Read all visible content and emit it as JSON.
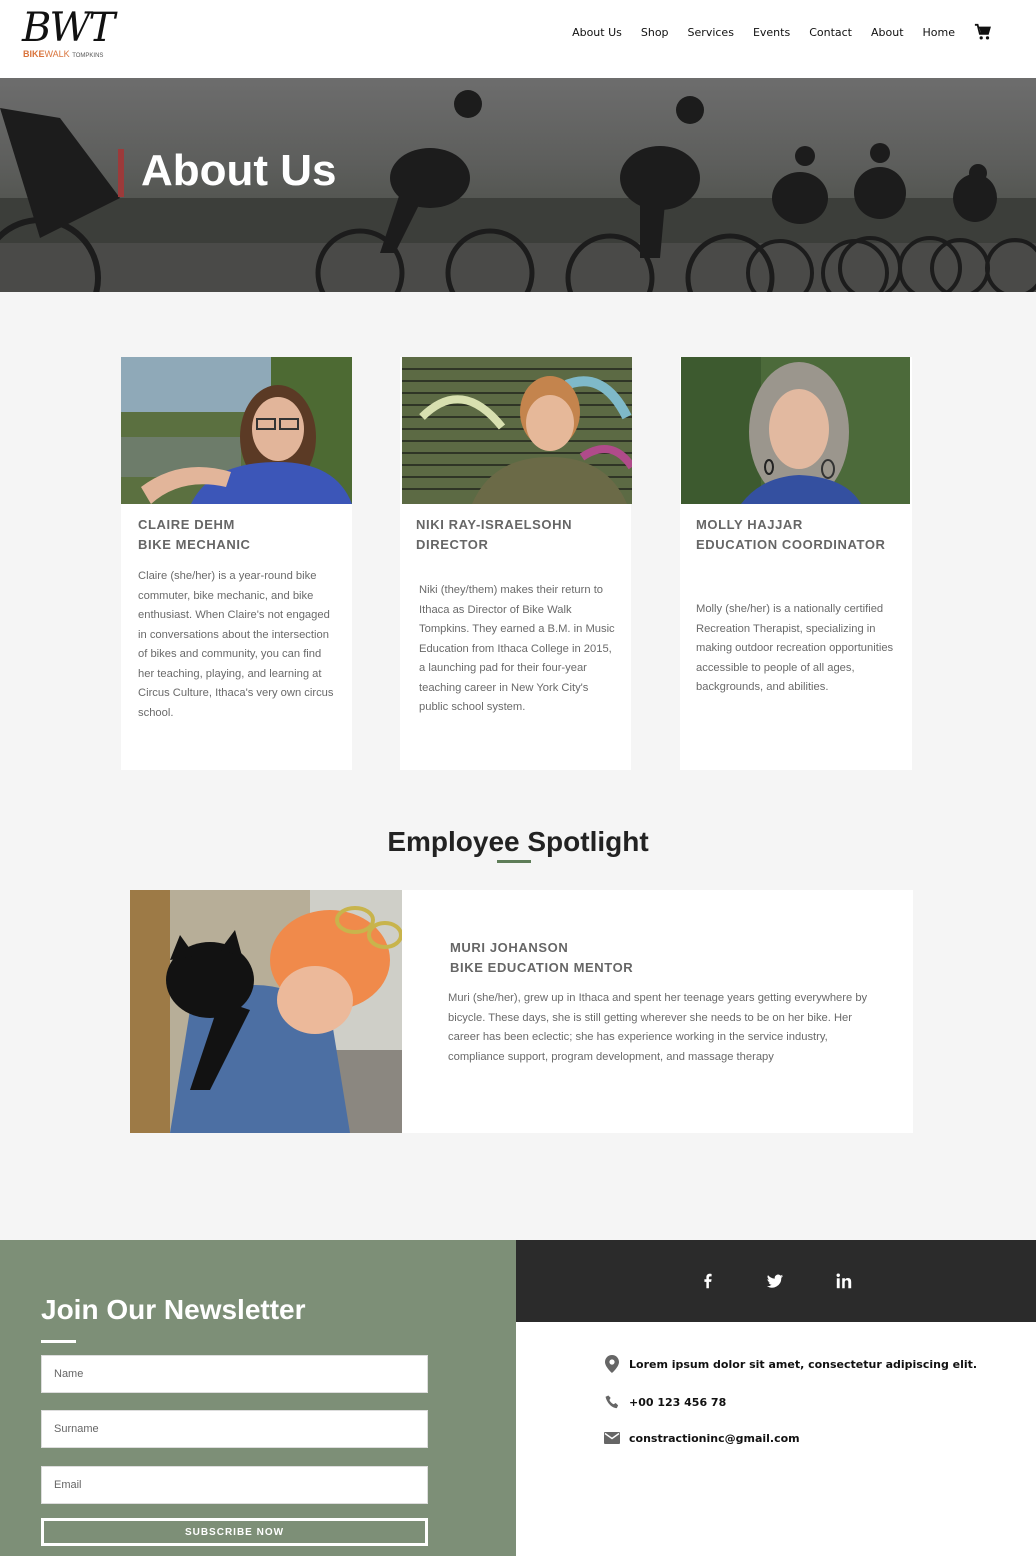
{
  "brand": {
    "script": "BWT",
    "sub_bike": "BIKE",
    "sub_walk": "WALK",
    "sub_tompkins": "TOMPKINS"
  },
  "nav": {
    "items": [
      "About Us",
      "Shop",
      "Services",
      "Events",
      "Contact",
      "About",
      "Home"
    ],
    "cart_icon": "cart-icon"
  },
  "hero": {
    "title": "About Us",
    "accent_color": "#9c3a3a"
  },
  "team": [
    {
      "name": "CLAIRE DEHM",
      "role": "BIKE MECHANIC",
      "bio": "Claire (she/her) is a year-round bike commuter, bike mechanic, and bike enthusiast. When Claire's not engaged in conversations about the intersection of bikes and community, you can find her teaching, playing, and learning at Circus Culture, Ithaca's very own circus school."
    },
    {
      "name": "NIKI RAY-ISRAELSOHN",
      "role": "DIRECTOR",
      "bio": "Niki (they/them) makes their return to Ithaca as Director of Bike Walk Tompkins. They earned a B.M. in Music Education from Ithaca College in 2015, a launching pad for their four-year teaching career in New York City's public school system."
    },
    {
      "name": "MOLLY HAJJAR",
      "role": "EDUCATION COORDINATOR",
      "bio": "Molly (she/her) is a nationally certified Recreation Therapist, specializing in making outdoor recreation opportunities accessible to people of all ages, backgrounds, and abilities."
    }
  ],
  "spotlight": {
    "title": "Employee Spotlight",
    "name": "MURI JOHANSON",
    "role": "BIKE EDUCATION MENTOR",
    "bio": "Muri (she/her), grew up in Ithaca and spent her teenage years getting everywhere by bicycle. These days, she is still getting wherever she needs to be on her bike. Her career has been eclectic; she has experience working in the service industry, compliance support, program development, and massage therapy",
    "accent_color": "#5e7d58"
  },
  "newsletter": {
    "title": "Join Our Newsletter",
    "name_placeholder": "Name",
    "surname_placeholder": "Surname",
    "email_placeholder": "Email",
    "button": "SUBSCRIBE NOW",
    "bg_color": "#7d8f77"
  },
  "social": {
    "icons": [
      "facebook-icon",
      "twitter-icon",
      "linkedin-icon"
    ],
    "bg_color": "#2b2b2b"
  },
  "contact": {
    "address": "Lorem ipsum dolor sit amet, consectetur adipiscing elit.",
    "phone": "+00 123 456 78",
    "email": "constractioninc@gmail.com"
  }
}
